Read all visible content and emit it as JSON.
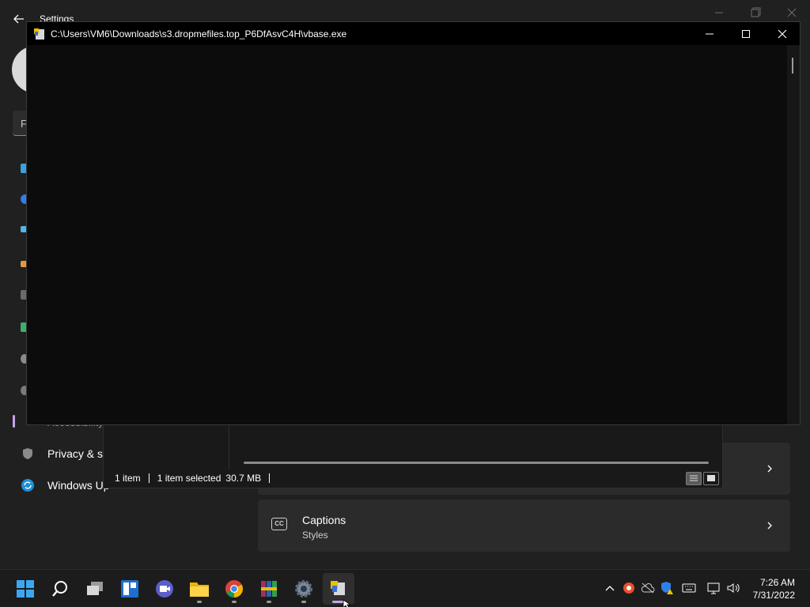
{
  "settings": {
    "title": "Settings",
    "find_placeholder": "F",
    "nav": {
      "accessibility_label": "Accessibility",
      "privacy_label": "Privacy & se",
      "update_label": "Windows Up"
    },
    "captions_card": {
      "title": "Captions",
      "subtitle": "Styles"
    }
  },
  "console": {
    "title": "C:\\Users\\VM6\\Downloads\\s3.dropmefiles.top_P6DfAsvC4H\\vbase.exe"
  },
  "explorer": {
    "status_items": "1 item",
    "status_selected": "1 item selected",
    "status_size": "30.7 MB"
  },
  "taskbar": {
    "apps": [
      "start-icon",
      "search-icon",
      "task-view-icon",
      "widgets-icon",
      "chat-icon",
      "file-explorer-icon",
      "chrome-icon",
      "winrar-icon",
      "settings-icon",
      "vbase-icon"
    ],
    "clock_time": "7:26 AM",
    "clock_date": "7/31/2022"
  },
  "colors": {
    "accent": "#c8a2e8",
    "console_bg": "#0c0c0c",
    "settings_bg": "#202020"
  }
}
